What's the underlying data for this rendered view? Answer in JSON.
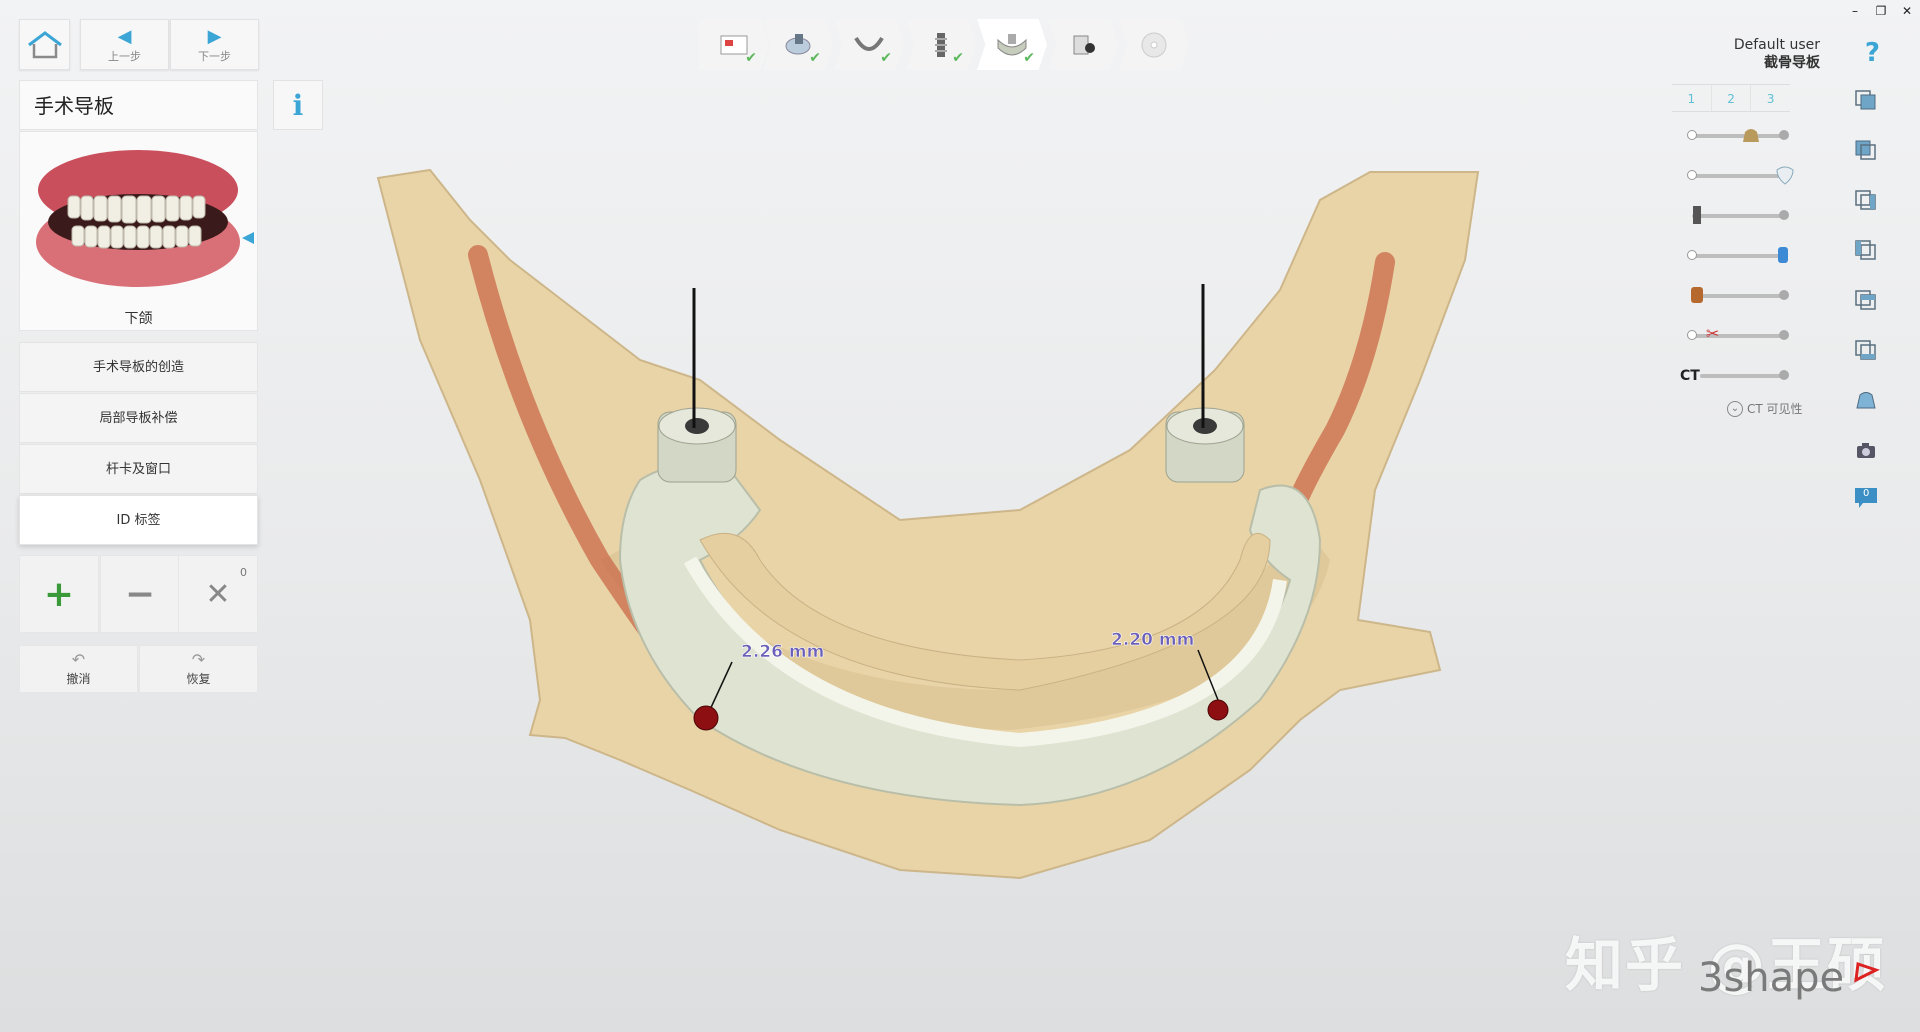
{
  "window": {
    "minimize": "–",
    "restore": "❐",
    "close": "✕"
  },
  "nav": {
    "back_label": "上一步",
    "next_label": "下一步"
  },
  "panel": {
    "title": "手术导板",
    "thumbnail_label": "下颌",
    "menu": [
      {
        "label": "手术导板的创造"
      },
      {
        "label": "局部导板补偿"
      },
      {
        "label": "杆卡及窗口"
      },
      {
        "label": "ID 标签"
      }
    ],
    "delete_count": "0",
    "undo_label": "撤消",
    "redo_label": "恢复"
  },
  "user": {
    "name": "Default user",
    "project": "截骨导板"
  },
  "tabs": [
    "1",
    "2",
    "3"
  ],
  "ct": {
    "label": "CT",
    "visibility_label": "CT 可见性"
  },
  "view": {
    "badge": "0"
  },
  "measurements": {
    "left": "2.26 mm",
    "right": "2.20 mm"
  },
  "watermark": {
    "text": "知乎 @王硕",
    "brand": "3shape"
  },
  "colors": {
    "accent": "#3ba5d6",
    "check": "#5cb85c",
    "bone": "#e8d3a6",
    "guide": "#dfe3d3"
  }
}
